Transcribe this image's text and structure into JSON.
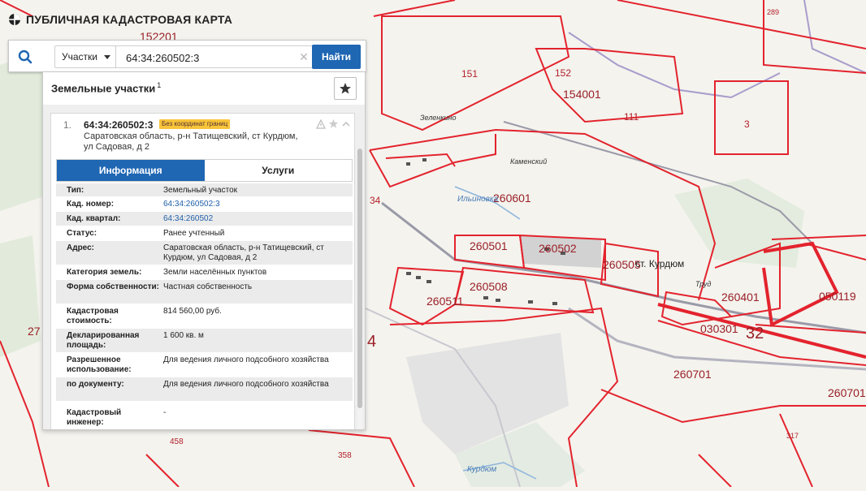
{
  "app": {
    "title": "ПУБЛИЧНАЯ КАДАСТРОВАЯ КАРТА"
  },
  "search": {
    "type_label": "Участки",
    "query": "64:34:260502:3",
    "find_label": "Найти"
  },
  "panel": {
    "title": "Земельные участки",
    "count": "1",
    "item": {
      "number": "1.",
      "cad_number": "64:34:260502:3",
      "badge": "Без координат границ",
      "address": "Саратовская область, р-н Татищевский, ст Курдюм, ул Садовая, д 2"
    },
    "tabs": [
      {
        "label": "Информация"
      },
      {
        "label": "Услуги"
      }
    ],
    "properties": [
      {
        "key": "Тип:",
        "value": "Земельный участок"
      },
      {
        "key": "Кад. номер:",
        "value": "64:34:260502:3"
      },
      {
        "key": "Кад. квартал:",
        "value": "64:34:260502"
      },
      {
        "key": "Статус:",
        "value": "Ранее учтенный"
      },
      {
        "key": "Адрес:",
        "value": "Саратовская область, р-н Татищевский, ст Курдюм, ул Садовая, д 2"
      },
      {
        "key": "Категория земель:",
        "value": "Земли населённых пунктов"
      },
      {
        "key": "Форма собственности:",
        "value": "Частная собственность"
      },
      {
        "key": "Кадастровая стоимость:",
        "value": "814 560,00 руб."
      },
      {
        "key": "Декларированная площадь:",
        "value": "1 600 кв. м"
      },
      {
        "key": "Разрешенное использование:",
        "value": "Для ведения личного подсобного хозяйства"
      },
      {
        "key": "по документу:",
        "value": "Для ведения личного подсобного хозяйства"
      },
      {
        "key": "Кадастровый инженер:",
        "value": "-"
      }
    ]
  },
  "map": {
    "labels": [
      {
        "text": "152201"
      },
      {
        "text": "151"
      },
      {
        "text": "152"
      },
      {
        "text": "154001"
      },
      {
        "text": "111"
      },
      {
        "text": "3"
      },
      {
        "text": "289"
      },
      {
        "text": "260601"
      },
      {
        "text": "260501"
      },
      {
        "text": "260502"
      },
      {
        "text": "260505"
      },
      {
        "text": "260508"
      },
      {
        "text": "260511"
      },
      {
        "text": "260401"
      },
      {
        "text": "050119"
      },
      {
        "text": "030301"
      },
      {
        "text": "32"
      },
      {
        "text": "260701"
      },
      {
        "text": "260701"
      },
      {
        "text": "34"
      },
      {
        "text": "27"
      },
      {
        "text": "4"
      },
      {
        "text": "458"
      },
      {
        "text": "358"
      },
      {
        "text": "317"
      },
      {
        "text": "ст. Курдюм"
      },
      {
        "text": "Зеленкино"
      },
      {
        "text": "Каменский"
      },
      {
        "text": "Труд"
      },
      {
        "text": "Ильиновка"
      },
      {
        "text": "Курдюм"
      }
    ]
  },
  "colors": {
    "accent": "#1f66b3",
    "parcel": "#e3232d",
    "badge": "#f8c43a"
  }
}
